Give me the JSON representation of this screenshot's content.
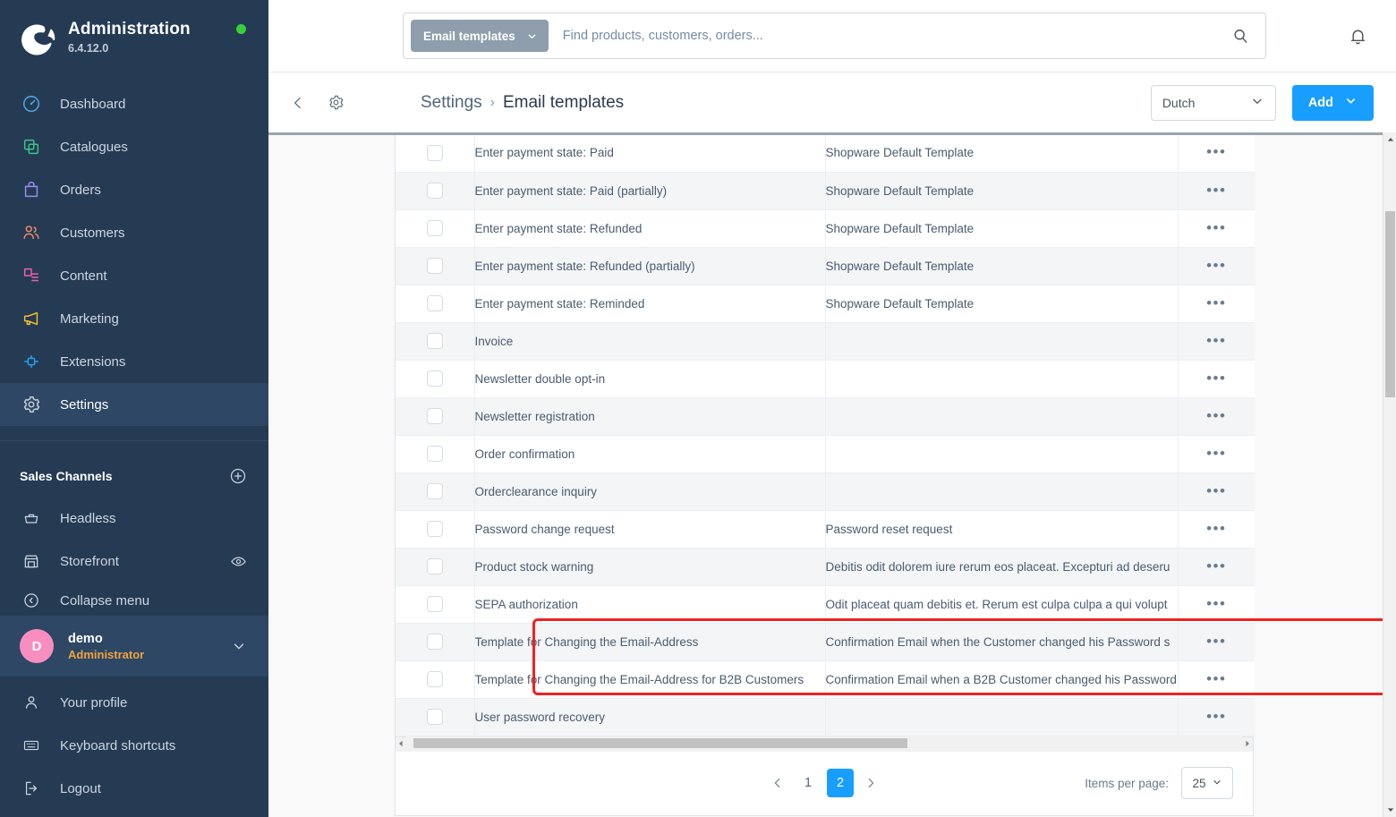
{
  "sidebar": {
    "app_title": "Administration",
    "version": "6.4.12.0",
    "logo_icon": "shopware-logo",
    "status_dot_color": "#37d03b",
    "nav_items": [
      {
        "label": "Dashboard",
        "icon": "dashboard-gauge-icon",
        "color": "#52a8e8",
        "active": false
      },
      {
        "label": "Catalogues",
        "icon": "catalogues-layers-icon",
        "color": "#3fc48a",
        "active": false
      },
      {
        "label": "Orders",
        "icon": "orders-bag-icon",
        "color": "#9b8cf0",
        "active": false
      },
      {
        "label": "Customers",
        "icon": "customers-people-icon",
        "color": "#f08a6a",
        "active": false
      },
      {
        "label": "Content",
        "icon": "content-page-icon",
        "color": "#ed5fb0",
        "active": false
      },
      {
        "label": "Marketing",
        "icon": "marketing-megaphone-icon",
        "color": "#f2c12e",
        "active": false
      },
      {
        "label": "Extensions",
        "icon": "extensions-plug-icon",
        "color": "#2b9dee",
        "active": false
      },
      {
        "label": "Settings",
        "icon": "settings-gear-icon",
        "color": "#c7cfd8",
        "active": true
      }
    ],
    "sales_channels_title": "Sales Channels",
    "sales_channels_add_icon": "plus-circle-icon",
    "channels": [
      {
        "label": "Headless",
        "icon": "basket-icon",
        "trailing_icon": ""
      },
      {
        "label": "Storefront",
        "icon": "storefront-icon",
        "trailing_icon": "eye-icon"
      },
      {
        "label": "Collapse menu",
        "icon": "collapse-arrow-icon",
        "trailing_icon": ""
      }
    ],
    "user": {
      "avatar_initial": "D",
      "avatar_color": "#f88ec0",
      "name": "demo",
      "role": "Administrator",
      "caret_icon": "chevron-down-icon"
    },
    "bottom_items": [
      {
        "label": "Your profile",
        "icon": "user-icon"
      },
      {
        "label": "Keyboard shortcuts",
        "icon": "keyboard-icon"
      },
      {
        "label": "Logout",
        "icon": "logout-icon"
      }
    ]
  },
  "topbar": {
    "filter_chip_label": "Email templates",
    "filter_chip_caret_icon": "chevron-down-icon",
    "search_value": "",
    "search_placeholder": "Find products, customers, orders...",
    "search_icon": "search-icon",
    "notification_icon": "bell-icon"
  },
  "smartbar": {
    "back_icon": "chevron-left-icon",
    "module_icon": "gear-icon",
    "breadcrumb_root": "Settings",
    "breadcrumb_sep": "›",
    "breadcrumb_current": "Email templates",
    "language_value": "Dutch",
    "language_caret_icon": "chevron-down-icon",
    "add_label": "Add",
    "add_caret_icon": "chevron-down-icon",
    "accent_color": "#189eff"
  },
  "table": {
    "action_icon": "context-menu-dots-icon",
    "rows": [
      {
        "name": "Enter payment state: Paid",
        "description": "Shopware Default Template"
      },
      {
        "name": "Enter payment state: Paid (partially)",
        "description": "Shopware Default Template"
      },
      {
        "name": "Enter payment state: Refunded",
        "description": "Shopware Default Template"
      },
      {
        "name": "Enter payment state: Refunded (partially)",
        "description": "Shopware Default Template"
      },
      {
        "name": "Enter payment state: Reminded",
        "description": "Shopware Default Template"
      },
      {
        "name": "Invoice",
        "description": ""
      },
      {
        "name": "Newsletter double opt-in",
        "description": ""
      },
      {
        "name": "Newsletter registration",
        "description": ""
      },
      {
        "name": "Order confirmation",
        "description": ""
      },
      {
        "name": "Orderclearance inquiry",
        "description": ""
      },
      {
        "name": "Password change request",
        "description": "Password reset request"
      },
      {
        "name": "Product stock warning",
        "description": "Debitis odit dolorem iure rerum eos placeat. Excepturi ad deseru"
      },
      {
        "name": "SEPA authorization",
        "description": "Odit placeat quam debitis et. Rerum est culpa culpa a qui volupt"
      },
      {
        "name": "Template for Changing the Email-Address",
        "description": "Confirmation Email when the Customer changed his Password s"
      },
      {
        "name": "Template for Changing the Email-Address for B2B Customers",
        "description": "Confirmation Email when a B2B Customer changed his Password"
      },
      {
        "name": "User password recovery",
        "description": ""
      }
    ]
  },
  "highlight": {
    "color": "#ee2222"
  },
  "footer": {
    "prev_icon": "chevron-left-icon",
    "next_icon": "chevron-right-icon",
    "pages": [
      "1",
      "2"
    ],
    "current_page": "2",
    "items_per_page_label": "Items per page:",
    "items_per_page_value": "25",
    "items_per_page_caret_icon": "chevron-down-icon"
  }
}
